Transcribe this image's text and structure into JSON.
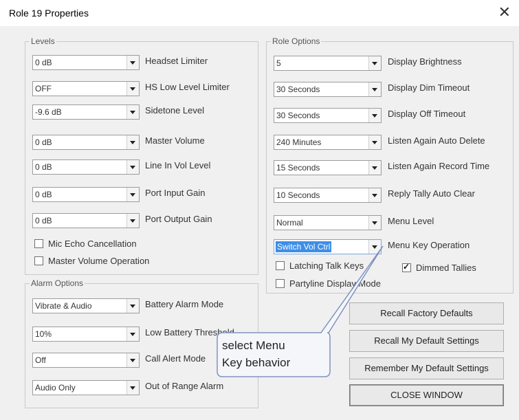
{
  "window": {
    "title": "Role 19 Properties",
    "close_glyph": "✕"
  },
  "levels": {
    "label": "Levels",
    "rows": [
      {
        "value": "0 dB",
        "label": "Headset Limiter"
      },
      {
        "value": "OFF",
        "label": "HS Low Level Limiter"
      },
      {
        "value": "-9.6 dB",
        "label": "Sidetone Level"
      },
      {
        "value": "0 dB",
        "label": "Master Volume"
      },
      {
        "value": "0 dB",
        "label": "Line In Vol Level"
      },
      {
        "value": "0 dB",
        "label": "Port Input Gain"
      },
      {
        "value": "0 dB",
        "label": "Port Output Gain"
      }
    ],
    "checks": [
      {
        "label": "Mic Echo Cancellation",
        "checked": false
      },
      {
        "label": "Master Volume Operation",
        "checked": false
      }
    ]
  },
  "alarm": {
    "label": "Alarm Options",
    "rows": [
      {
        "value": "Vibrate & Audio",
        "label": "Battery Alarm Mode"
      },
      {
        "value": "10%",
        "label": "Low Battery Threshold"
      },
      {
        "value": "Off",
        "label": "Call Alert Mode"
      },
      {
        "value": "Audio Only",
        "label": "Out of Range Alarm"
      }
    ]
  },
  "role": {
    "label": "Role Options",
    "rows": [
      {
        "value": "5",
        "label": "Display Brightness"
      },
      {
        "value": "30 Seconds",
        "label": "Display Dim Timeout"
      },
      {
        "value": "30 Seconds",
        "label": "Display Off Timeout"
      },
      {
        "value": "240 Minutes",
        "label": "Listen Again Auto Delete"
      },
      {
        "value": "15 Seconds",
        "label": "Listen Again Record Time"
      },
      {
        "value": "10 Seconds",
        "label": "Reply Tally Auto Clear"
      },
      {
        "value": "Normal",
        "label": "Menu Level"
      },
      {
        "value": "Switch Vol Ctrl",
        "label": "Menu Key Operation"
      }
    ],
    "checks": [
      {
        "label": "Latching Talk Keys",
        "checked": false
      },
      {
        "label": "Dimmed Tallies",
        "checked": true
      },
      {
        "label": "Partyline Display Mode",
        "checked": false
      }
    ]
  },
  "buttons": {
    "recall_factory": "Recall Factory Defaults",
    "recall_my": "Recall My Default Settings",
    "remember_my": "Remember My Default Settings",
    "close_window": "CLOSE WINDOW"
  },
  "callout": {
    "line1": "select Menu",
    "line2": "Key behavior"
  }
}
